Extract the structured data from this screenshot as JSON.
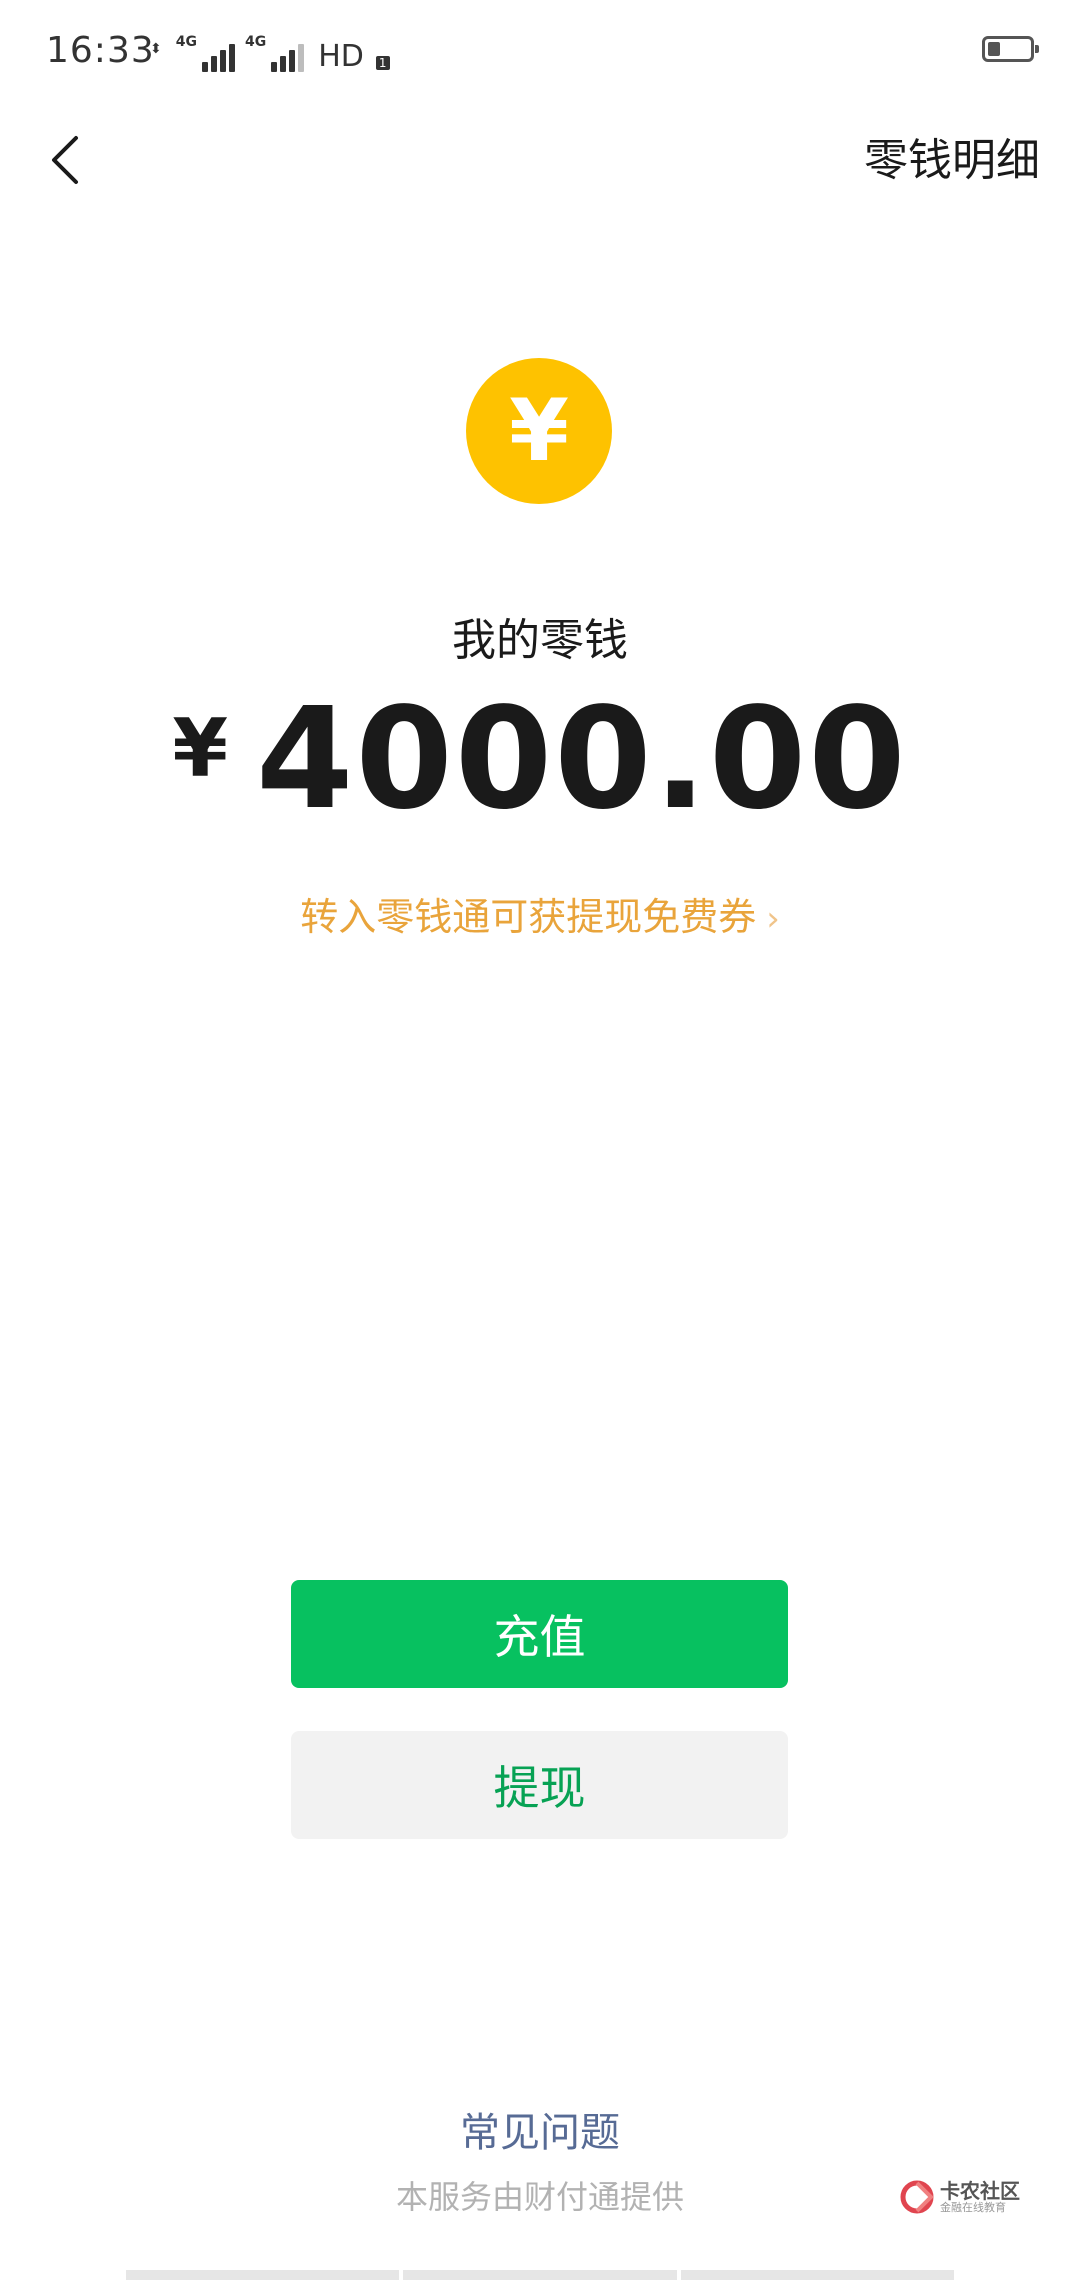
{
  "status_bar": {
    "time": "16:33",
    "network1": "4G",
    "network2": "4G",
    "hd": "HD",
    "hd_sub": "1",
    "battery_level": 0.3
  },
  "nav": {
    "details_label": "零钱明细"
  },
  "coin_symbol": "¥",
  "balance": {
    "label": "我的零钱",
    "currency": "¥",
    "amount": "4000.00"
  },
  "promo": {
    "text": "转入零钱通可获提现免费券",
    "chevron": "›"
  },
  "buttons": {
    "recharge": "充值",
    "withdraw": "提现"
  },
  "footer": {
    "faq": "常见问题",
    "provider": "本服务由财付通提供"
  },
  "watermark": {
    "title": "卡农社区",
    "subtitle": "金融在线教育"
  },
  "colors": {
    "accent_green": "#07c160",
    "coin_yellow": "#fec200",
    "promo_orange": "#e9a43b",
    "link_blue": "#576b95"
  }
}
